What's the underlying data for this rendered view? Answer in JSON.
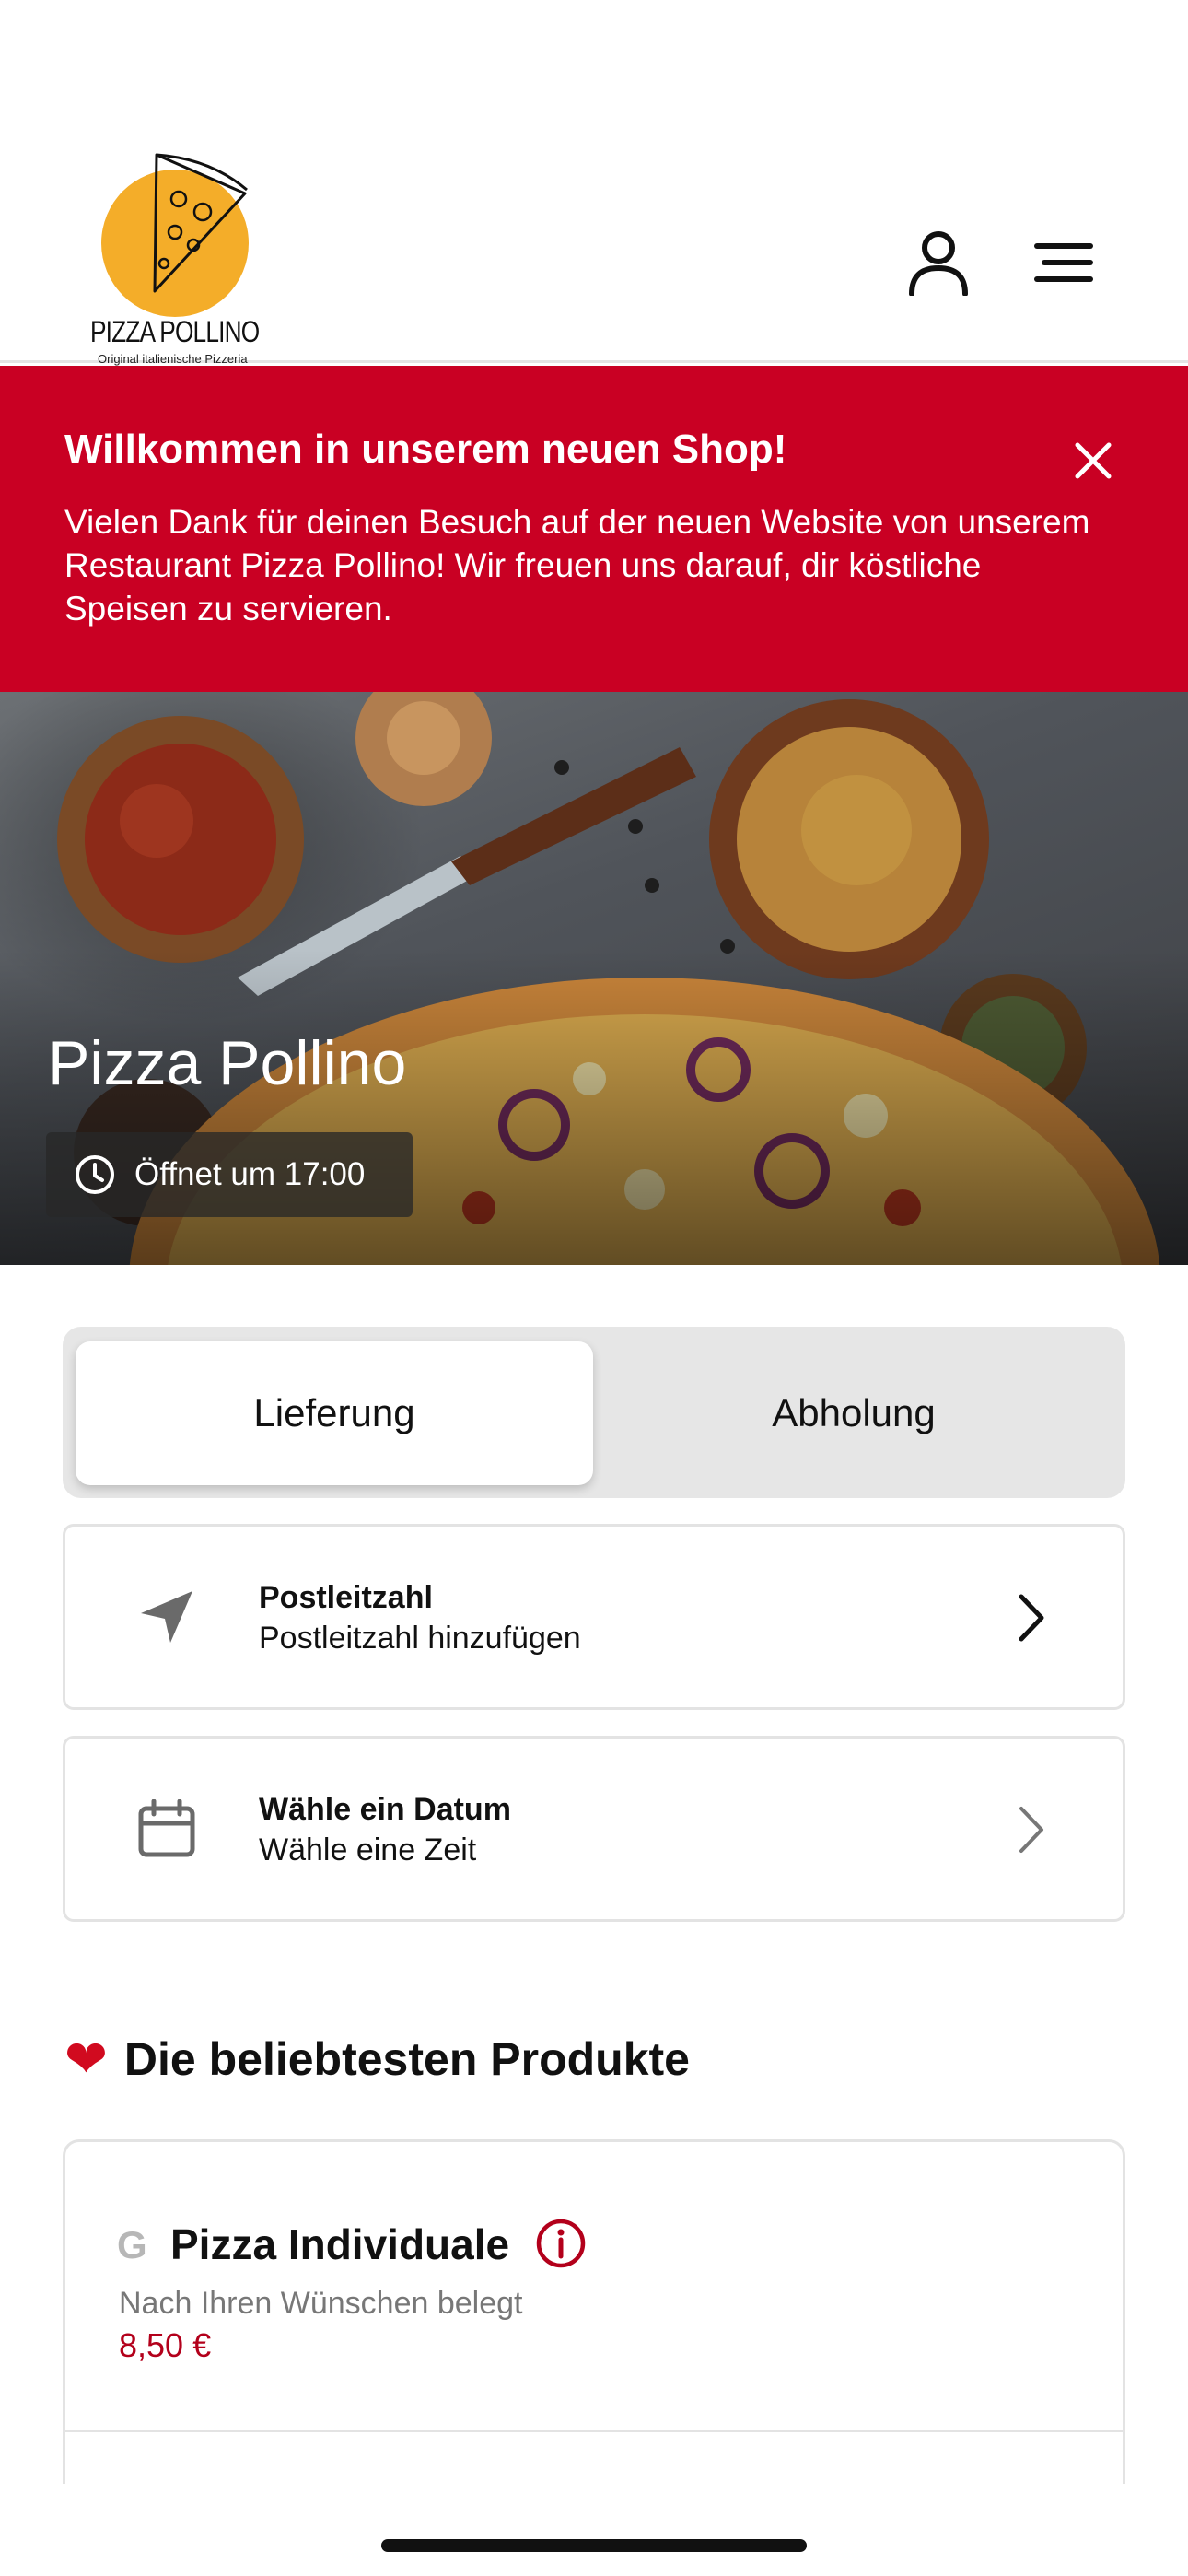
{
  "header": {
    "logo_name": "PIZZA POLLINO",
    "logo_tagline": "Original italienische Pizzeria"
  },
  "banner": {
    "title": "Willkommen in unserem neuen Shop!",
    "text": "Vielen Dank für deinen Besuch auf der neuen Website von unserem Restaurant Pizza Pollino! Wir freuen uns darauf, dir köstliche Speisen zu servieren."
  },
  "hero": {
    "title": "Pizza Pollino",
    "opening": "Öffnet um 17:00"
  },
  "mode_toggle": {
    "delivery": "Lieferung",
    "pickup": "Abholung",
    "selected": "delivery"
  },
  "zip_card": {
    "title": "Postleitzahl",
    "subtitle": "Postleitzahl hinzufügen"
  },
  "date_card": {
    "title": "Wähle ein Datum",
    "subtitle": "Wähle eine Zeit"
  },
  "popular": {
    "heading": "Die beliebtesten Produkte",
    "products": [
      {
        "badge": "G",
        "name": "Pizza Individuale",
        "description": "Nach Ihren Wünschen belegt",
        "price": "8,50 €"
      }
    ]
  },
  "colors": {
    "brand_red": "#c90023",
    "logo_yellow": "#f4ad29",
    "price_red": "#b3001b"
  },
  "icons": [
    "user-icon",
    "menu-icon",
    "close-icon",
    "clock-icon",
    "location-arrow-icon",
    "calendar-icon",
    "chevron-right-icon",
    "heart-icon",
    "info-icon"
  ]
}
